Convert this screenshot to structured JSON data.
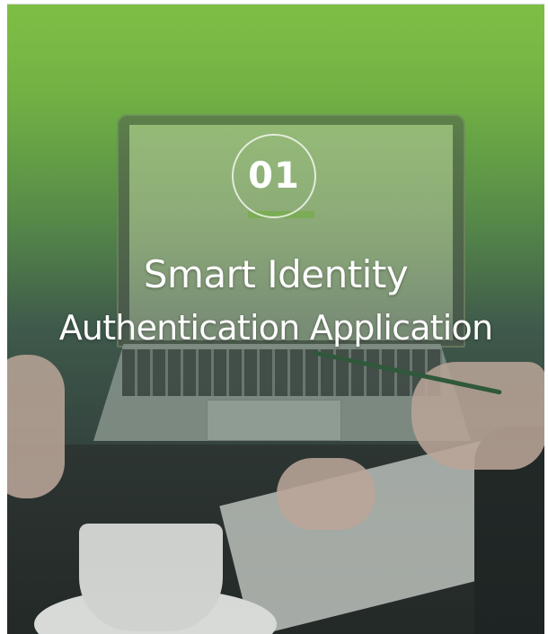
{
  "card": {
    "number": "01",
    "title_line1": "Smart Identity",
    "title_line2": "Authentication Application"
  },
  "colors": {
    "accent_green": "#7dbe45",
    "text": "#ffffff"
  }
}
